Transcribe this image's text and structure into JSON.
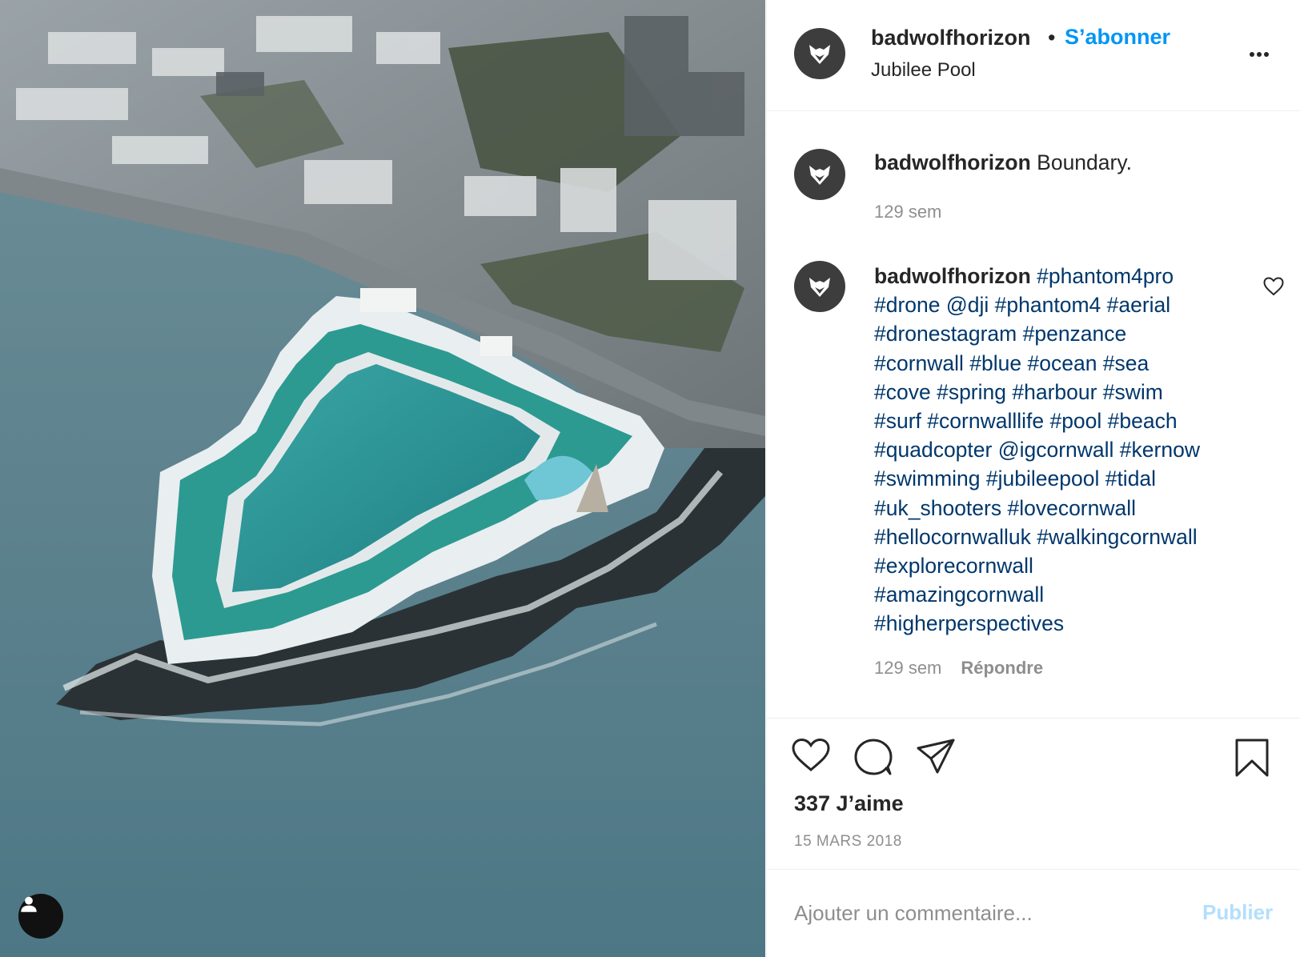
{
  "post": {
    "photo_alt": "Aerial drone photo of Jubilee Pool, a triangular tidal lido on the coast in front of a town",
    "user_tag_icon": "user-icon"
  },
  "header": {
    "username": "badwolfhorizon",
    "separator": "•",
    "follow_label": "S’abonner",
    "location": "Jubilee Pool",
    "more_icon": "more-options-icon"
  },
  "comments": [
    {
      "username": "badwolfhorizon",
      "text": "Boundary.",
      "time": "129 sem"
    },
    {
      "username": "badwolfhorizon",
      "lines": [
        "#phantom4pro",
        "#drone @dji #phantom4 #aerial",
        "#dronestagram #penzance",
        "#cornwall #blue #ocean #sea",
        "#cove #spring #harbour #swim",
        "#surf #cornwalllife #pool #beach",
        "#quadcopter @igcornwall #kernow",
        "#swimming #jubileepool #tidal",
        "#uk_shooters #lovecornwall",
        "#hellocornwalluk #walkingcornwall",
        "#explorecornwall",
        "#amazingcornwall",
        "#higherperspectives"
      ],
      "time": "129 sem",
      "reply_label": "Répondre"
    }
  ],
  "actions": {
    "likes": "337 J’aime",
    "date": "15 MARS 2018"
  },
  "comment_box": {
    "placeholder": "Ajouter un commentaire...",
    "publish_label": "Publier"
  },
  "colors": {
    "link_blue": "#0095f6",
    "hashtag_blue": "#00376b",
    "muted_gray": "#8e8e8e",
    "publish_disabled": "#b2dffc"
  }
}
